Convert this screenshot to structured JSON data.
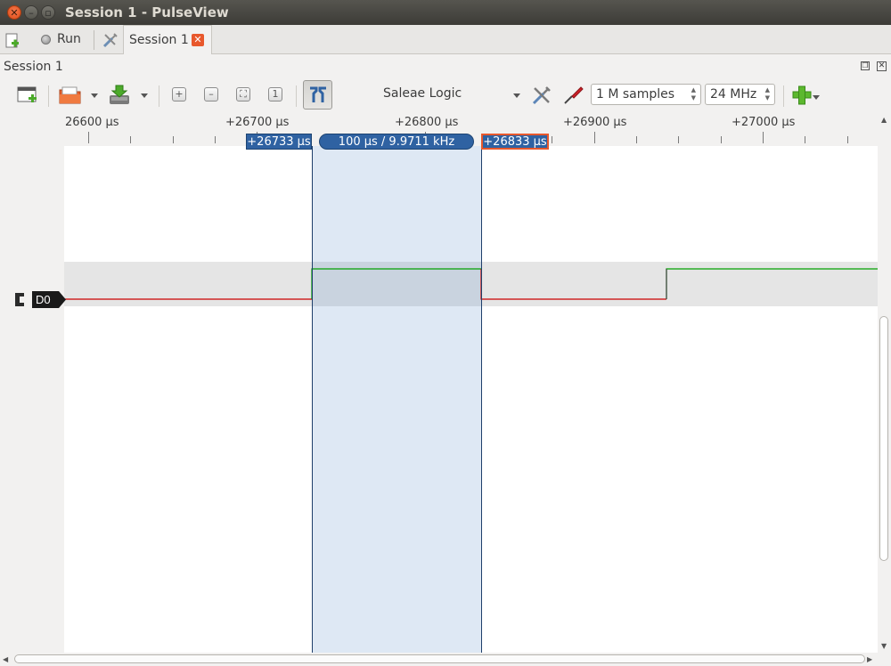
{
  "window": {
    "title": "Session 1 - PulseView"
  },
  "tabbar": {
    "run_label": "Run",
    "session_tab_label": "Session 1"
  },
  "session": {
    "header": "Session 1"
  },
  "toolbar": {
    "device": "Saleae Logic",
    "samples": "1 M samples",
    "samplerate": "24 MHz"
  },
  "ruler": {
    "labels": [
      "26600 µs",
      "+26700 µs",
      "+26800 µs",
      "+26900 µs",
      "+27000 µs"
    ]
  },
  "cursors": {
    "cursor1": "+26733 µs",
    "cursor2": "+26833 µs",
    "measurement": "100 µs / 9.9711 kHz"
  },
  "channels": [
    {
      "name": "D0",
      "low_color": "#cc0000",
      "high_color": "#00a000"
    }
  ],
  "colors": {
    "selection": "#5b8bc8",
    "cursor_flag": "#2f62a2",
    "accent": "#e8582c"
  }
}
